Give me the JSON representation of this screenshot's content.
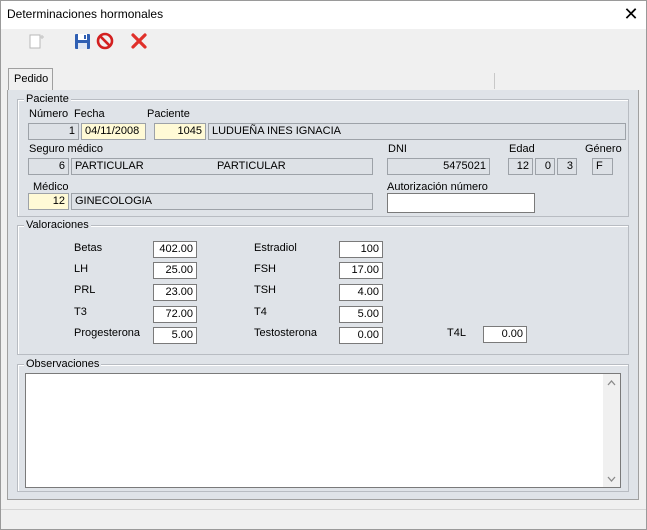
{
  "window": {
    "title": "Determinaciones hormonales",
    "close_glyph": "✕"
  },
  "toolbar": {
    "icons": [
      "new-icon",
      "save-icon",
      "cancel-icon",
      "delete-icon"
    ]
  },
  "tabs": [
    {
      "label": "Pedido"
    }
  ],
  "paciente": {
    "group_label": "Paciente",
    "numero_label": "Número",
    "numero": "1",
    "fecha_label": "Fecha",
    "fecha": "04/11/2008",
    "paciente_label": "Paciente",
    "paciente_id": "1045",
    "paciente_nombre": "LUDUEÑA INES IGNACIA",
    "seguro_label": "Seguro médico",
    "seguro_id": "6",
    "seguro_nombre": "PARTICULAR",
    "seguro_plan": "PARTICULAR",
    "dni_label": "DNI",
    "dni": "5475021",
    "edad_label": "Edad",
    "edad_anios": "12",
    "edad_meses": "0",
    "edad_dias": "3",
    "genero_label": "Género",
    "genero": "F",
    "medico_label": "Médico",
    "medico_id": "12",
    "medico_nombre": "GINECOLOGIA",
    "autorizacion_label": "Autorización número",
    "autorizacion": ""
  },
  "valoraciones": {
    "group_label": "Valoraciones",
    "betas_label": "Betas",
    "betas": "402.00",
    "lh_label": "LH",
    "lh": "25.00",
    "prl_label": "PRL",
    "prl": "23.00",
    "t3_label": "T3",
    "t3": "72.00",
    "progesterona_label": "Progesterona",
    "progesterona": "5.00",
    "estradiol_label": "Estradiol",
    "estradiol": "100",
    "fsh_label": "FSH",
    "fsh": "17.00",
    "tsh_label": "TSH",
    "tsh": "4.00",
    "t4_label": "T4",
    "t4": "5.00",
    "testosterona_label": "Testosterona",
    "testosterona": "0.00",
    "t4l_label": "T4L",
    "t4l": "0.00"
  },
  "observaciones": {
    "group_label": "Observaciones",
    "text": ""
  }
}
